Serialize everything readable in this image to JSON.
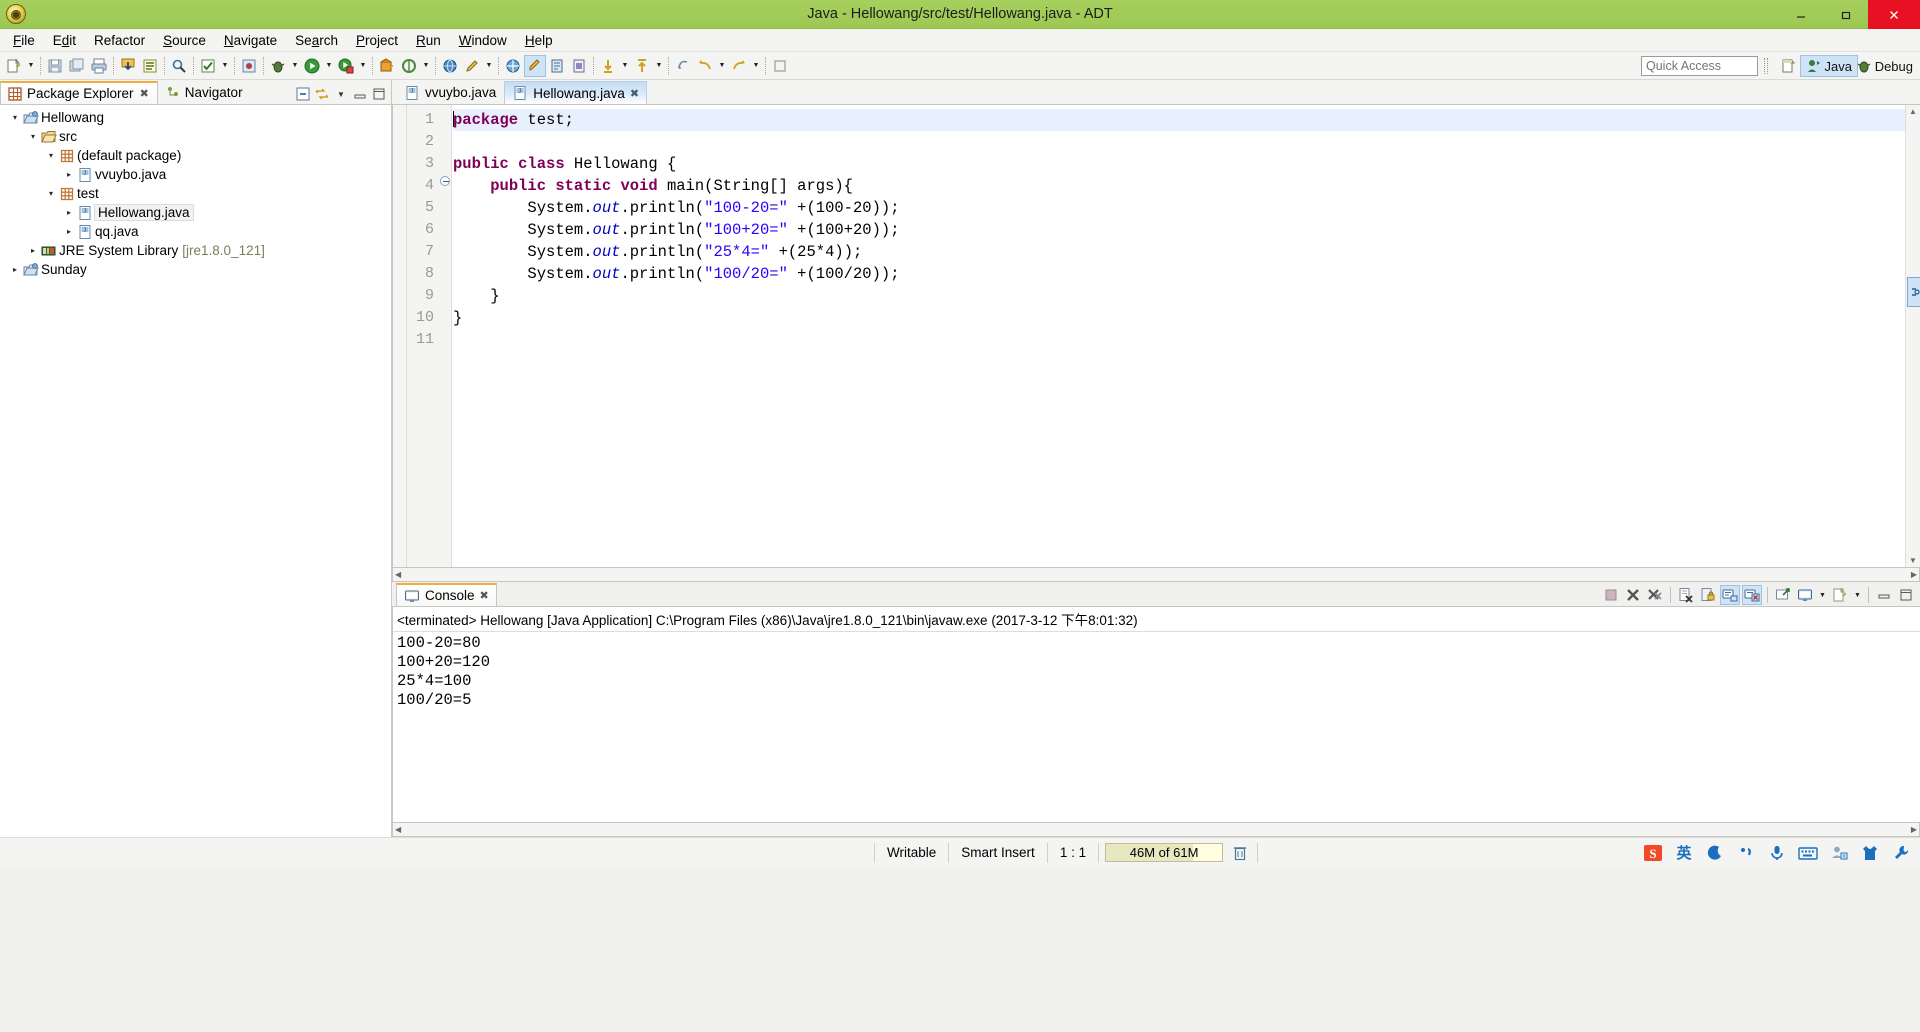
{
  "window": {
    "title": "Java - Hellowang/src/test/Hellowang.java - ADT",
    "app_icon": "eclipse-adt-icon",
    "minimize": "minimize-icon",
    "maximize": "restore-icon",
    "close": "close-icon",
    "titlebar_color": "#a2cc58"
  },
  "menu": {
    "items": [
      "File",
      "Edit",
      "Refactor",
      "Source",
      "Navigate",
      "Search",
      "Project",
      "Run",
      "Window",
      "Help"
    ]
  },
  "toolbar": {
    "quick_access_placeholder": "Quick Access",
    "quick_access_value": "",
    "perspective_new_icon": "new-perspective-icon",
    "perspectives": [
      {
        "label": "Java",
        "icon": "java-perspective-icon",
        "active": true
      },
      {
        "label": "Debug",
        "icon": "debug-perspective-icon",
        "active": false
      }
    ],
    "buttons": [
      "new-wizard-icon",
      "save-icon",
      "save-all-icon",
      "print-icon",
      "export-icon",
      "open-type-icon",
      "search-icon",
      "build-icon",
      "skip-breakpoints-icon",
      "debug-icon",
      "run-icon",
      "coverage-icon",
      "new-android-project-icon",
      "android-sdk-manager-icon",
      "avd-manager-icon",
      "lint-icon",
      "new-java-package-icon",
      "new-java-class-icon",
      "new-java-interface-icon",
      "open-declaration-icon",
      "next-annotation-icon",
      "previous-annotation-icon",
      "last-edit-location-icon",
      "back-icon",
      "forward-icon",
      "pin-editor-icon"
    ]
  },
  "explorer": {
    "tabs": [
      {
        "label": "Package Explorer",
        "icon": "package-explorer-icon",
        "active": true,
        "closable": true
      },
      {
        "label": "Navigator",
        "icon": "navigator-icon",
        "active": false,
        "closable": false
      }
    ],
    "view_buttons": [
      "collapse-all-icon",
      "link-with-editor-icon",
      "view-menu-icon",
      "minimize-icon",
      "maximize-icon"
    ],
    "tree": [
      {
        "label": "Hellowang",
        "icon": "java-project-icon",
        "indent": 0,
        "twisty": "expanded",
        "selected": false
      },
      {
        "label": "src",
        "icon": "source-folder-icon",
        "indent": 1,
        "twisty": "expanded",
        "selected": false
      },
      {
        "label": "(default package)",
        "icon": "package-icon",
        "indent": 2,
        "twisty": "expanded",
        "selected": false
      },
      {
        "label": "vvuybo.java",
        "icon": "java-file-icon",
        "indent": 3,
        "twisty": "collapsed",
        "selected": false
      },
      {
        "label": "test",
        "icon": "package-icon",
        "indent": 2,
        "twisty": "expanded",
        "selected": false
      },
      {
        "label": "Hellowang.java",
        "icon": "java-file-icon",
        "indent": 3,
        "twisty": "collapsed",
        "selected": true
      },
      {
        "label": "qq.java",
        "icon": "java-file-icon",
        "indent": 3,
        "twisty": "collapsed",
        "selected": false
      },
      {
        "label": "JRE System Library",
        "suffix": "[jre1.8.0_121]",
        "icon": "jre-library-icon",
        "indent": 1,
        "twisty": "collapsed",
        "selected": false
      },
      {
        "label": "Sunday",
        "icon": "java-project-icon",
        "indent": 0,
        "twisty": "collapsed",
        "selected": false
      }
    ]
  },
  "editor": {
    "tabs": [
      {
        "label": "vvuybo.java",
        "icon": "java-file-icon",
        "active": false,
        "closable": false
      },
      {
        "label": "Hellowang.java",
        "icon": "java-file-icon",
        "active": true,
        "closable": true
      }
    ],
    "cursor_line": 1,
    "lines": [
      {
        "n": 1,
        "highlight": true,
        "fold": false,
        "tokens": [
          {
            "t": "package",
            "c": "kw"
          },
          {
            "t": " test;",
            "c": ""
          }
        ]
      },
      {
        "n": 2,
        "highlight": false,
        "fold": false,
        "tokens": []
      },
      {
        "n": 3,
        "highlight": false,
        "fold": false,
        "tokens": [
          {
            "t": "public class",
            "c": "kw"
          },
          {
            "t": " Hellowang {",
            "c": ""
          }
        ]
      },
      {
        "n": 4,
        "highlight": false,
        "fold": true,
        "tokens": [
          {
            "t": "    ",
            "c": ""
          },
          {
            "t": "public static void",
            "c": "kw"
          },
          {
            "t": " main(String[] args){",
            "c": ""
          }
        ]
      },
      {
        "n": 5,
        "highlight": false,
        "fold": false,
        "tokens": [
          {
            "t": "        System.",
            "c": ""
          },
          {
            "t": "out",
            "c": "fld"
          },
          {
            "t": ".println(",
            "c": ""
          },
          {
            "t": "\"100-20=\"",
            "c": "str"
          },
          {
            "t": " +(100-20));",
            "c": ""
          }
        ]
      },
      {
        "n": 6,
        "highlight": false,
        "fold": false,
        "tokens": [
          {
            "t": "        System.",
            "c": ""
          },
          {
            "t": "out",
            "c": "fld"
          },
          {
            "t": ".println(",
            "c": ""
          },
          {
            "t": "\"100+20=\"",
            "c": "str"
          },
          {
            "t": " +(100+20));",
            "c": ""
          }
        ]
      },
      {
        "n": 7,
        "highlight": false,
        "fold": false,
        "tokens": [
          {
            "t": "        System.",
            "c": ""
          },
          {
            "t": "out",
            "c": "fld"
          },
          {
            "t": ".println(",
            "c": ""
          },
          {
            "t": "\"25*4=\"",
            "c": "str"
          },
          {
            "t": " +(25*4));",
            "c": ""
          }
        ]
      },
      {
        "n": 8,
        "highlight": false,
        "fold": false,
        "tokens": [
          {
            "t": "        System.",
            "c": ""
          },
          {
            "t": "out",
            "c": "fld"
          },
          {
            "t": ".println(",
            "c": ""
          },
          {
            "t": "\"100/20=\"",
            "c": "str"
          },
          {
            "t": " +(100/20));",
            "c": ""
          }
        ]
      },
      {
        "n": 9,
        "highlight": false,
        "fold": false,
        "tokens": [
          {
            "t": "    }",
            "c": ""
          }
        ]
      },
      {
        "n": 10,
        "highlight": false,
        "fold": false,
        "tokens": [
          {
            "t": "}",
            "c": ""
          }
        ]
      },
      {
        "n": 11,
        "highlight": false,
        "fold": false,
        "tokens": []
      }
    ]
  },
  "console": {
    "tab_label": "Console",
    "tab_icon": "console-icon",
    "header": "<terminated> Hellowang [Java Application] C:\\Program Files (x86)\\Java\\jre1.8.0_121\\bin\\javaw.exe (2017-3-12 下午8:01:32)",
    "output_lines": [
      "100-20=80",
      "100+20=120",
      "25*4=100",
      "100/20=5"
    ],
    "toolbar_buttons": [
      {
        "icon": "terminate-icon",
        "active": false
      },
      {
        "icon": "remove-launch-icon",
        "active": false
      },
      {
        "icon": "remove-all-terminated-icon",
        "active": false
      },
      {
        "icon": "clear-console-icon",
        "active": false
      },
      {
        "icon": "scroll-lock-icon",
        "active": false
      },
      {
        "icon": "show-console-on-output-icon",
        "active": true
      },
      {
        "icon": "show-console-on-error-icon",
        "active": true
      },
      {
        "icon": "pin-console-icon",
        "active": false
      },
      {
        "icon": "display-selected-console-icon",
        "active": false
      },
      {
        "icon": "open-console-icon",
        "active": false
      },
      {
        "icon": "minimize-icon",
        "active": false
      },
      {
        "icon": "maximize-icon",
        "active": false
      }
    ]
  },
  "statusbar": {
    "writable": "Writable",
    "insert_mode": "Smart Insert",
    "position": "1 : 1",
    "heap": "46M of 61M",
    "heap_percent": 75,
    "trash_icon": "trash-icon",
    "tray_icons": [
      "sogou-logo-icon",
      "ime-chinese-english-icon",
      "ime-moon-icon",
      "ime-punctuation-icon",
      "ime-voice-icon",
      "ime-keyboard-icon",
      "ime-user-icon",
      "ime-skin-icon",
      "ime-toolbox-icon"
    ]
  }
}
